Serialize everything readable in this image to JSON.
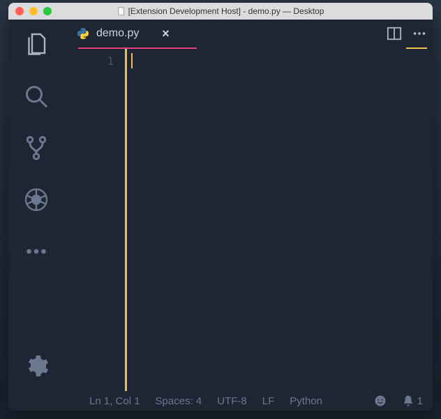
{
  "titlebar": {
    "title": "[Extension Development Host] - demo.py — Desktop"
  },
  "tab": {
    "filename": "demo.py"
  },
  "editor": {
    "line_number": "1"
  },
  "statusbar": {
    "cursor_pos": "Ln 1, Col 1",
    "indent": "Spaces: 4",
    "encoding": "UTF-8",
    "eol": "LF",
    "language": "Python",
    "notifications": "1"
  }
}
